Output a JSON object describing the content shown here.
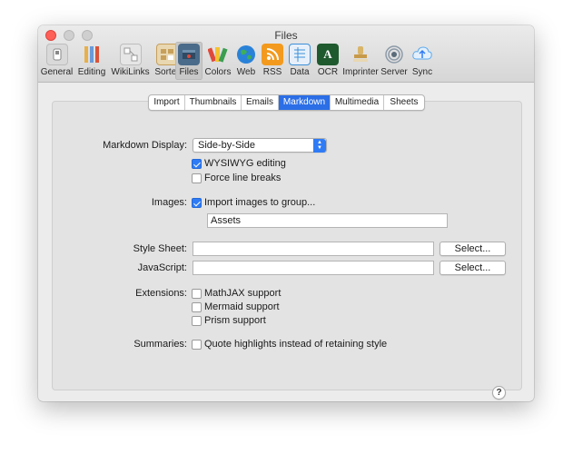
{
  "window": {
    "title": "Files"
  },
  "toolbar": {
    "items": [
      {
        "label": "General",
        "icon": "general-icon",
        "color": "#d9d9d9"
      },
      {
        "label": "Editing",
        "icon": "editing-icon",
        "color": "#e8b04a"
      },
      {
        "label": "WikiLinks",
        "icon": "wikilinks-icon",
        "color": "#c9c9c9"
      },
      {
        "label": "Sorter",
        "icon": "sorter-icon",
        "color": "#c7a05b"
      },
      {
        "label": "Files",
        "icon": "files-icon",
        "color": "#4a6b8a",
        "active": true
      },
      {
        "label": "Colors",
        "icon": "colors-icon",
        "color": "#e04a3a"
      },
      {
        "label": "Web",
        "icon": "globe-icon",
        "color": "#2a82d8"
      },
      {
        "label": "RSS",
        "icon": "rss-icon",
        "color": "#f39a1e"
      },
      {
        "label": "Data",
        "icon": "data-icon",
        "color": "#3d8fd8"
      },
      {
        "label": "OCR",
        "icon": "ocr-icon",
        "color": "#1f5a2e"
      },
      {
        "label": "Imprinter",
        "icon": "imprinter-icon",
        "color": "#d9b56a"
      },
      {
        "label": "Server",
        "icon": "server-icon",
        "color": "#8c9aa8"
      },
      {
        "label": "Sync",
        "icon": "sync-icon",
        "color": "#5aa9ee"
      }
    ]
  },
  "tabs": [
    {
      "label": "Import"
    },
    {
      "label": "Thumbnails"
    },
    {
      "label": "Emails"
    },
    {
      "label": "Markdown",
      "selected": true
    },
    {
      "label": "Multimedia"
    },
    {
      "label": "Sheets"
    }
  ],
  "markdown": {
    "display_label": "Markdown Display:",
    "display_value": "Side-by-Side",
    "wysiwyg_label": "WYSIWYG editing",
    "wysiwyg_checked": true,
    "line_breaks_label": "Force line breaks",
    "line_breaks_checked": false,
    "images_label": "Images:",
    "import_images_label": "Import images to group...",
    "import_images_checked": true,
    "group_value": "Assets",
    "stylesheet_label": "Style Sheet:",
    "stylesheet_value": "",
    "stylesheet_button": "Select...",
    "javascript_label": "JavaScript:",
    "javascript_value": "",
    "javascript_button": "Select...",
    "extensions_label": "Extensions:",
    "mathjax_label": "MathJAX support",
    "mermaid_label": "Mermaid support",
    "prism_label": "Prism support",
    "summaries_label": "Summaries:",
    "quote_highlights_label": "Quote highlights instead of retaining style",
    "help_label": "?"
  },
  "colors": {
    "accent": "#2f7bf5",
    "tab_selected": "#2b6ee6",
    "close_button": "#fe5f57"
  }
}
